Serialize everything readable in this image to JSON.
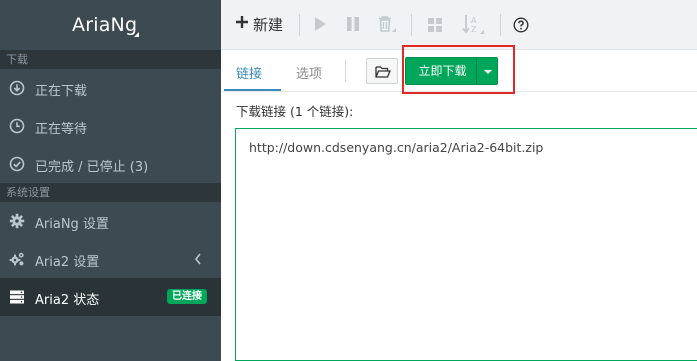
{
  "app": {
    "name": "AriaNg"
  },
  "sidebar": {
    "section_download": "下载",
    "download_items": [
      {
        "label": "正在下载",
        "icon": "download-circle-icon"
      },
      {
        "label": "正在等待",
        "icon": "clock-icon"
      },
      {
        "label": "已完成 / 已停止 (3)",
        "icon": "check-circle-icon"
      }
    ],
    "section_settings": "系统设置",
    "settings_items": [
      {
        "label": "AriaNg 设置",
        "icon": "gear-icon"
      },
      {
        "label": "Aria2 设置",
        "icon": "gears-icon"
      },
      {
        "label": "Aria2 状态",
        "icon": "server-icon",
        "badge": "已连接"
      }
    ]
  },
  "toolbar": {
    "new_label": "新建",
    "buttons": [
      "play-icon",
      "pause-icon",
      "trash-icon",
      "grid-icon",
      "sort-icon",
      "help-icon"
    ]
  },
  "tabs": {
    "link": "链接",
    "options": "选项"
  },
  "actions": {
    "download_now": "立即下载"
  },
  "content": {
    "links_label": "下载链接 (1 个链接):",
    "url_value": "http://down.cdsenyang.cn/aria2/Aria2-64bit.zip"
  },
  "colors": {
    "sidebar_bg": "#3e4a51",
    "accent_blue": "#3c8dbc",
    "success_green": "#00a65a",
    "highlight_red": "#e02a2a"
  }
}
